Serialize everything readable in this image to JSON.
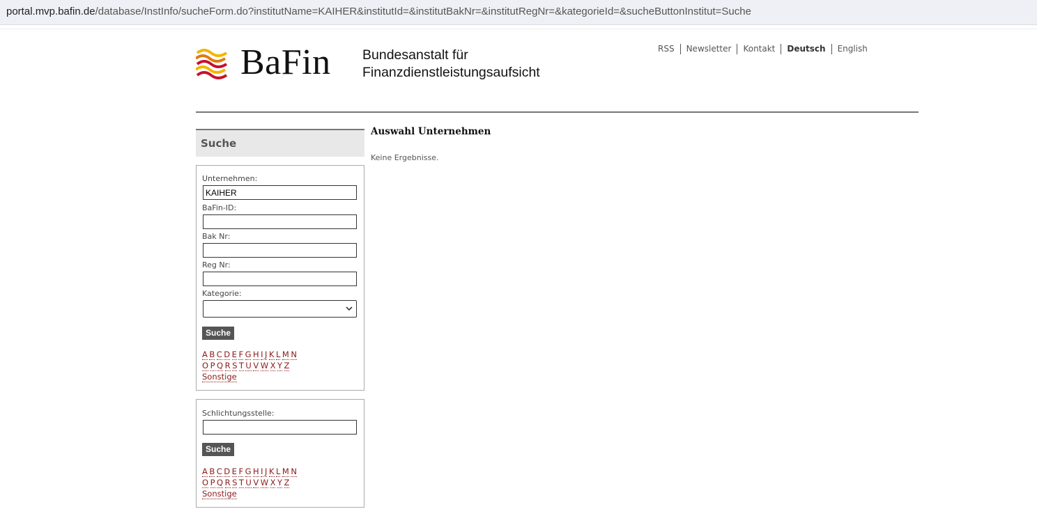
{
  "browser": {
    "url_host": "portal.mvp.bafin.de",
    "url_path": "/database/InstInfo/sucheForm.do?institutName=KAIHER&institutId=&institutBakNr=&institutRegNr=&kategorieId=&sucheButtonInstitut=Suche"
  },
  "header": {
    "logo_word": "BaFin",
    "org_line1": "Bundesanstalt für",
    "org_line2": "Finanzdienstleistungsaufsicht",
    "nav": [
      "RSS",
      "Newsletter",
      "Kontakt",
      "Deutsch",
      "English"
    ],
    "active_lang": "Deutsch"
  },
  "sidebar": {
    "heading": "Suche",
    "form1": {
      "unternehmen_label": "Unternehmen:",
      "unternehmen_value": "KAIHER",
      "bafin_id_label": "BaFin-ID:",
      "bak_nr_label": "Bak Nr:",
      "reg_nr_label": "Reg Nr:",
      "kategorie_label": "Kategorie:",
      "search_button": "Suche"
    },
    "form2": {
      "schlichtung_label": "Schlichtungsstelle:",
      "search_button": "Suche"
    },
    "alphabet_row1": [
      "A",
      "B",
      "C",
      "D",
      "E",
      "F",
      "G",
      "H",
      "I",
      "J",
      "K",
      "L",
      "M",
      "N"
    ],
    "alphabet_row2": [
      "O",
      "P",
      "Q",
      "R",
      "S",
      "T",
      "U",
      "V",
      "W",
      "X",
      "Y",
      "Z"
    ],
    "other_link": "Sonstige"
  },
  "main": {
    "title": "Auswahl Unternehmen",
    "message": "Keine Ergebnisse."
  },
  "colors": {
    "accent_red": "#8b1a1a",
    "button_grey": "#555555"
  }
}
